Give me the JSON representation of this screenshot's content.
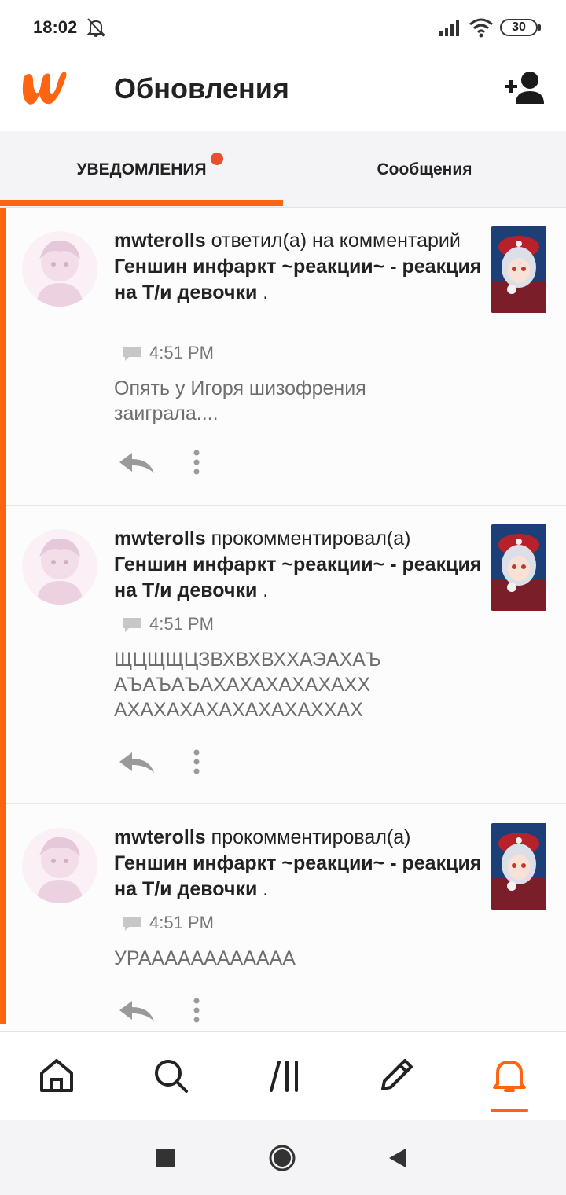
{
  "status_bar": {
    "time": "18:02",
    "battery": "30"
  },
  "header": {
    "title": "Обновления"
  },
  "tabs": [
    {
      "label": "УВЕДОМЛЕНИЯ",
      "active": true,
      "has_badge": true
    },
    {
      "label": "Сообщения",
      "active": false
    }
  ],
  "accent_color": "#ff6410",
  "notifications": [
    {
      "user": "mwterolls",
      "action": "ответил(а) на",
      "action2": "комментарий",
      "story": "Геншин инфаркт ~реакции~ - реакция на Т/и девочки",
      "suffix": ".",
      "time": "4:51 PM",
      "comment": "Опять у Игоря шизофрения заиграла...."
    },
    {
      "user": "mwterolls",
      "action": "прокомментировал(а)",
      "action2": "",
      "story": "Геншин инфаркт ~реакции~ - реакция на Т/и девочки",
      "suffix": ".",
      "time": "4:51 PM",
      "comment": "ЩЦЩЩЦЗВХВХВХХАЭАХАЪ АЪАЪАЪАХАХАХАХАХАХХ АХАХАХАХАХАХАХАХХАХ"
    },
    {
      "user": "mwterolls",
      "action": "прокомментировал(а)",
      "action2": "",
      "story": "Геншин инфаркт ~реакции~ - реакция на Т/и девочки",
      "suffix": ".",
      "time": "4:51 PM",
      "comment": "УРАААААААААААА"
    }
  ],
  "bottom_nav": [
    {
      "icon": "home-icon"
    },
    {
      "icon": "search-icon"
    },
    {
      "icon": "library-icon"
    },
    {
      "icon": "write-icon"
    },
    {
      "icon": "bell-icon",
      "active": true
    }
  ]
}
